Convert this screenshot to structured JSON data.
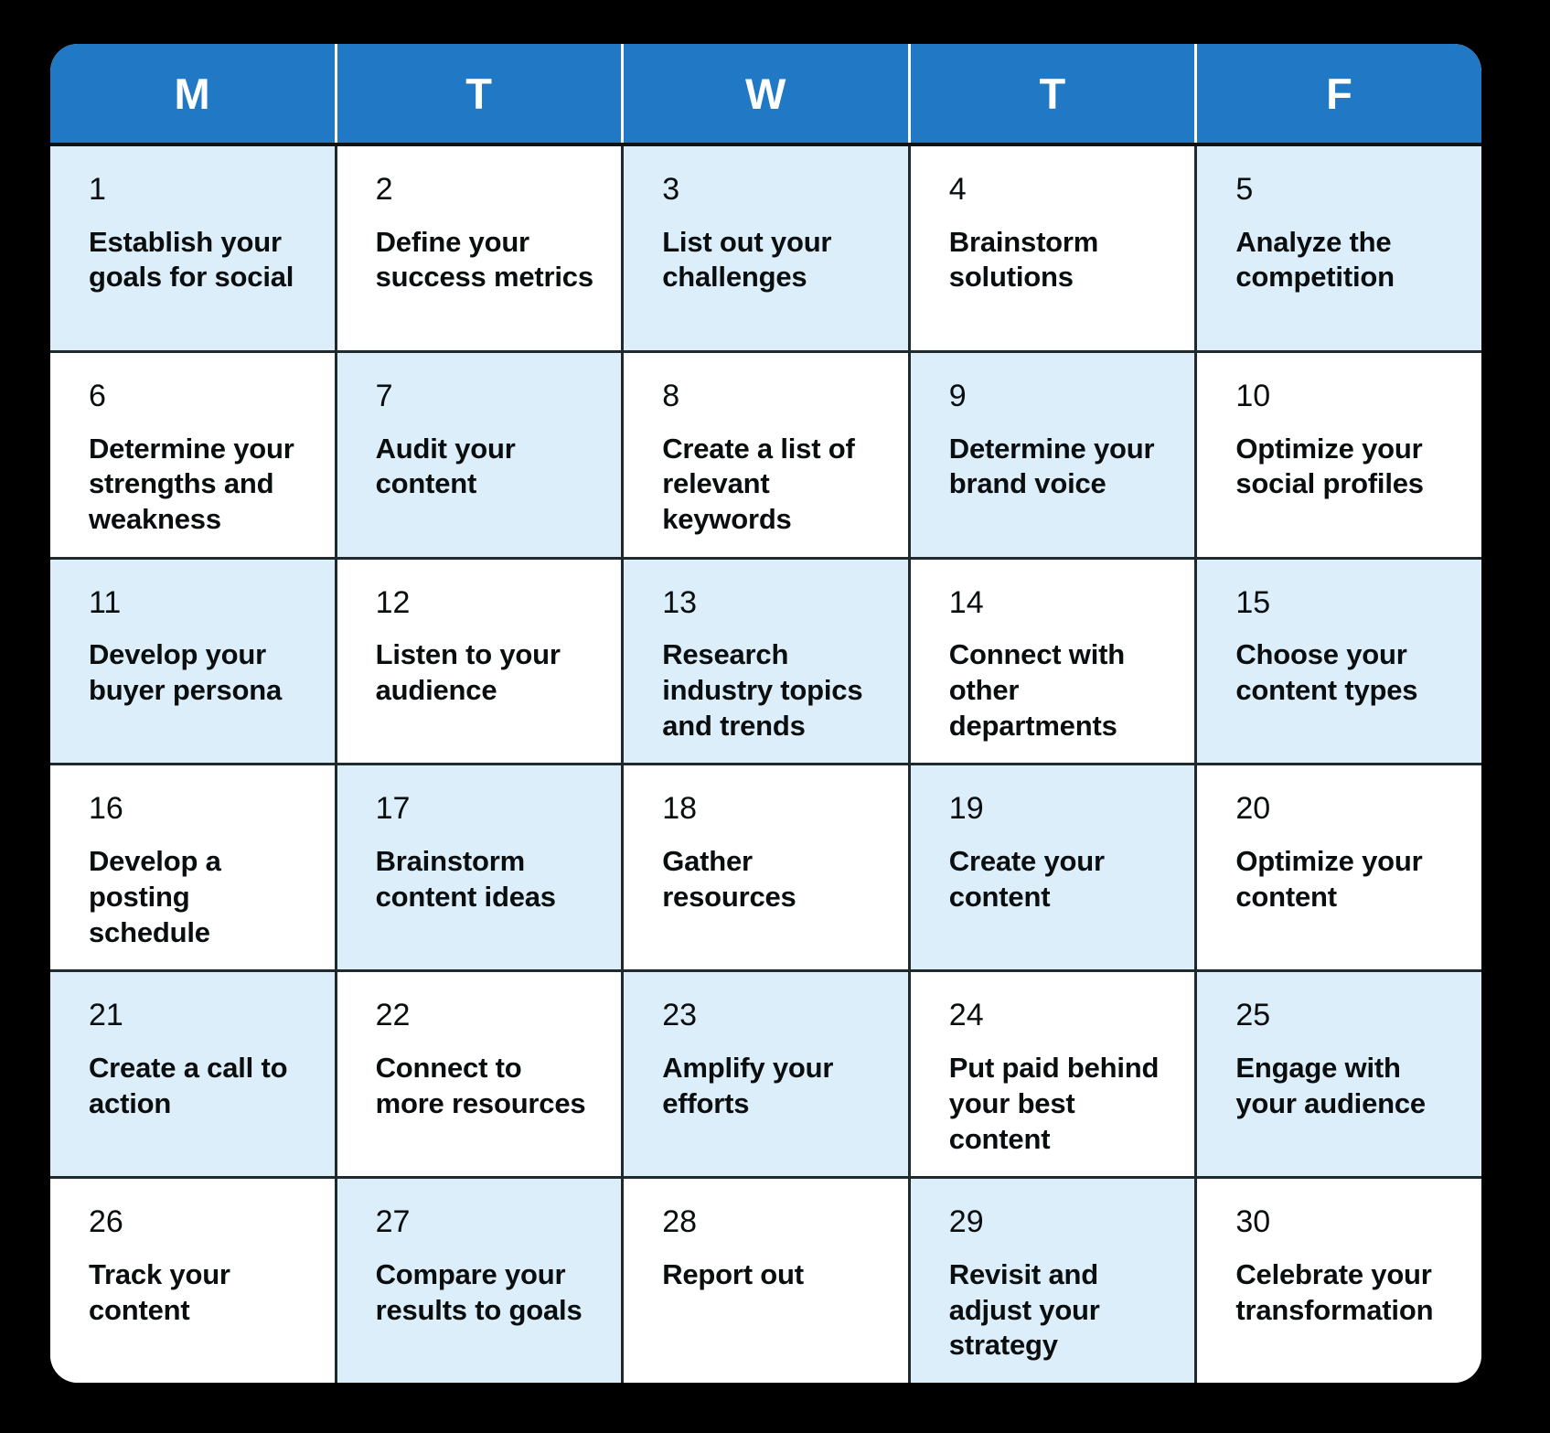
{
  "colors": {
    "page_background": "#000000",
    "card_background": "#ffffff",
    "header_blue": "#2178c4",
    "shaded_cell_blue": "#ddeefb",
    "divider": "#1e2a2e",
    "text": "#0b0e0f",
    "header_text": "#ffffff"
  },
  "header": {
    "days": [
      {
        "label": "M"
      },
      {
        "label": "T"
      },
      {
        "label": "W"
      },
      {
        "label": "T"
      },
      {
        "label": "F"
      }
    ]
  },
  "weeks": [
    [
      {
        "number": "1",
        "task": "Establish your goals for social",
        "shaded": true
      },
      {
        "number": "2",
        "task": "Define your success metrics",
        "shaded": false
      },
      {
        "number": "3",
        "task": "List out your challenges",
        "shaded": true
      },
      {
        "number": "4",
        "task": "Brainstorm solutions",
        "shaded": false
      },
      {
        "number": "5",
        "task": "Analyze the competition",
        "shaded": true
      }
    ],
    [
      {
        "number": "6",
        "task": "Determine your strengths and weakness",
        "shaded": false
      },
      {
        "number": "7",
        "task": "Audit your content",
        "shaded": true
      },
      {
        "number": "8",
        "task": "Create a list of relevant keywords",
        "shaded": false
      },
      {
        "number": "9",
        "task": "Determine your brand voice",
        "shaded": true
      },
      {
        "number": "10",
        "task": "Optimize your social profiles",
        "shaded": false
      }
    ],
    [
      {
        "number": "11",
        "task": "Develop your buyer persona",
        "shaded": true
      },
      {
        "number": "12",
        "task": "Listen to your audience",
        "shaded": false
      },
      {
        "number": "13",
        "task": "Research industry topics and trends",
        "shaded": true
      },
      {
        "number": "14",
        "task": "Connect with other departments",
        "shaded": false
      },
      {
        "number": "15",
        "task": "Choose your content types",
        "shaded": true
      }
    ],
    [
      {
        "number": "16",
        "task": "Develop a posting schedule",
        "shaded": false
      },
      {
        "number": "17",
        "task": "Brainstorm content ideas",
        "shaded": true
      },
      {
        "number": "18",
        "task": "Gather resources",
        "shaded": false
      },
      {
        "number": "19",
        "task": "Create your content",
        "shaded": true
      },
      {
        "number": "20",
        "task": "Optimize your content",
        "shaded": false
      }
    ],
    [
      {
        "number": "21",
        "task": "Create a call to action",
        "shaded": true
      },
      {
        "number": "22",
        "task": "Connect to more resources",
        "shaded": false
      },
      {
        "number": "23",
        "task": "Amplify your efforts",
        "shaded": true
      },
      {
        "number": "24",
        "task": "Put paid behind your best content",
        "shaded": false
      },
      {
        "number": "25",
        "task": "Engage with your audience",
        "shaded": true
      }
    ],
    [
      {
        "number": "26",
        "task": "Track your content",
        "shaded": false
      },
      {
        "number": "27",
        "task": "Compare your results to goals",
        "shaded": true
      },
      {
        "number": "28",
        "task": "Report out",
        "shaded": false
      },
      {
        "number": "29",
        "task": "Revisit and adjust your strategy",
        "shaded": true
      },
      {
        "number": "30",
        "task": "Celebrate your transformation",
        "shaded": false
      }
    ]
  ]
}
